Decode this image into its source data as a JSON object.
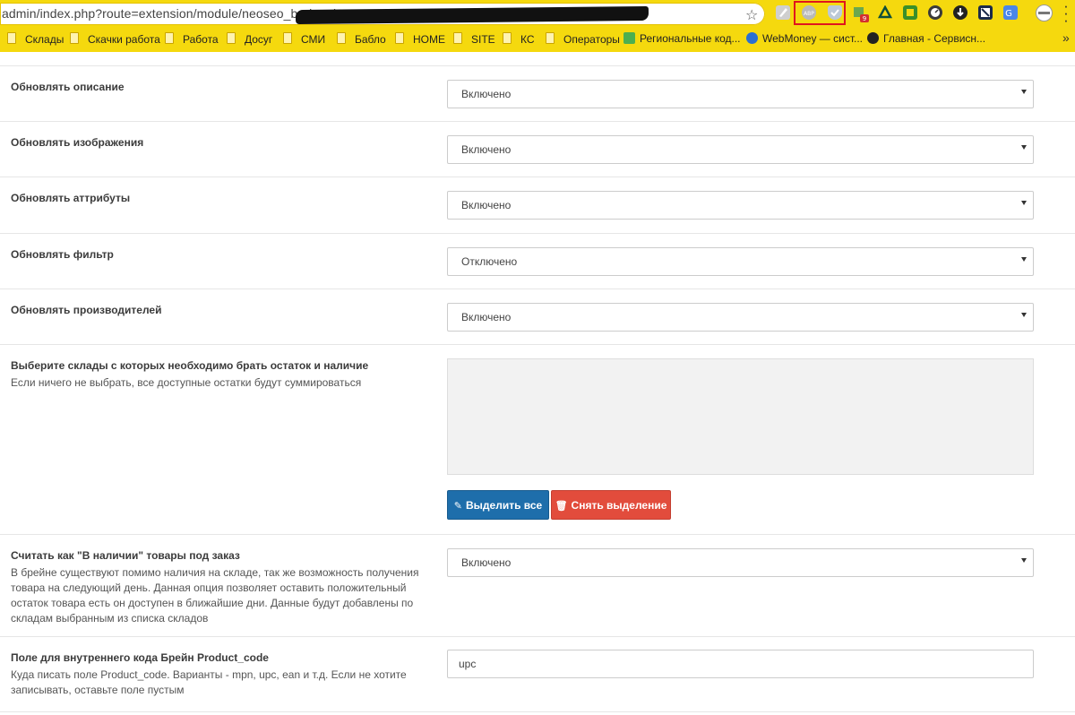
{
  "browser": {
    "url": "admin/index.php?route=extension/module/neoseo_brainapi&",
    "bookmarks": [
      {
        "label": "Склады"
      },
      {
        "label": "Скачки работа"
      },
      {
        "label": "Работа"
      },
      {
        "label": "Досуг"
      },
      {
        "label": "СМИ"
      },
      {
        "label": "Бабло"
      },
      {
        "label": "HOME"
      },
      {
        "label": "SITE"
      },
      {
        "label": "КС"
      },
      {
        "label": "Операторы"
      },
      {
        "label": "Региональные код..."
      },
      {
        "label": "WebMoney — сист..."
      },
      {
        "label": "Главная - Сервисн..."
      }
    ],
    "extensions": [
      "pen-icon",
      "abp-icon",
      "shield-check-icon",
      "puzzle-badge-icon",
      "drive-icon",
      "green-square-icon",
      "speedometer-icon",
      "download-icon",
      "box-icon",
      "translate-icon",
      "profile-icon"
    ],
    "badge": "9",
    "colors": {
      "toolbar": "#f5d90e",
      "highlight": "#e0141e"
    }
  },
  "form": {
    "update_description": {
      "label": "Обновлять описание",
      "value": "Включено"
    },
    "update_images": {
      "label": "Обновлять изображения",
      "value": "Включено"
    },
    "update_attributes": {
      "label": "Обновлять аттрибуты",
      "value": "Включено"
    },
    "update_filter": {
      "label": "Обновлять фильтр",
      "value": "Отключено"
    },
    "update_manufacturers": {
      "label": "Обновлять производителей",
      "value": "Включено"
    },
    "warehouses": {
      "label": "Выберите склады с которых необходимо брать остаток и наличие",
      "help": "Если ничего не выбрать, все доступные остатки будут суммироваться",
      "select_all": "Выделить все",
      "deselect": "Снять выделение"
    },
    "preorder": {
      "label": "Считать как \"В наличии\" товары под заказ",
      "help": "В брейне существуют помимо наличия на складе, так же возможность получения товара на следующий день. Данная опция позволяет оставить положительный остаток товара есть он доступен в ближайшие дни. Данные будут добавлены по складам выбранным из списка складов",
      "value": "Включено"
    },
    "product_code": {
      "label": "Поле для внутреннего кода Брейн Product_code",
      "help": "Куда писать поле Product_code. Варианты - mpn, upc, ean и т.д. Если не хотите записывать, оставьте поле пустым",
      "value": "upc"
    },
    "colors": {
      "primary": "#1e6eab",
      "danger": "#e24c3c"
    }
  }
}
